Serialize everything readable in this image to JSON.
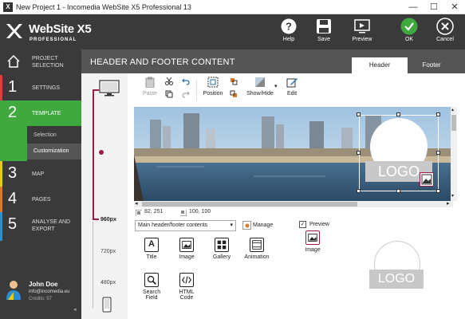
{
  "window": {
    "title": "New Project 1 - Incomedia WebSite X5 Professional 13",
    "minimize": "—",
    "maximize": "☐",
    "close": "✕"
  },
  "brand": {
    "name": "WebSite X5",
    "edition": "PROFESSIONAL"
  },
  "toolbar_top": {
    "help": "Help",
    "save": "Save",
    "preview": "Preview",
    "ok": "OK",
    "cancel": "Cancel"
  },
  "nav": [
    {
      "num": "",
      "label1": "PROJECT",
      "label2": "SELECTION",
      "color": "#3a3a3a"
    },
    {
      "num": "1",
      "label1": "SETTINGS",
      "label2": "",
      "color": "#e03c3c"
    },
    {
      "num": "2",
      "label1": "TEMPLATE",
      "label2": "",
      "color": "#3fa83f"
    },
    {
      "num": "3",
      "label1": "MAP",
      "label2": "",
      "color": "#e6c81e"
    },
    {
      "num": "4",
      "label1": "PAGES",
      "label2": "",
      "color": "#e07820"
    },
    {
      "num": "5",
      "label1": "ANALYSE AND",
      "label2": "EXPORT",
      "color": "#2a8fd0"
    }
  ],
  "subnav": {
    "selection": "Selection",
    "customization": "Customization"
  },
  "user": {
    "name": "John Doe",
    "email": "info@incomedia.eu",
    "credits": "Credits: 57"
  },
  "page": {
    "title": "HEADER AND FOOTER CONTENT",
    "tab_header": "Header",
    "tab_footer": "Footer"
  },
  "devices": {
    "w960": "960px",
    "w720": "720px",
    "w480": "480px"
  },
  "tools": {
    "paste": "Paste",
    "position": "Position",
    "showhide": "Show/Hide",
    "edit": "Edit"
  },
  "canvas": {
    "logo_text": "LOGO",
    "coord_pos": "82, 251",
    "coord_size": "100, 100"
  },
  "controls": {
    "select_value": "Main header/footer contents",
    "manage": "Manage",
    "preview_label": "Preview",
    "preview_checked": "✓"
  },
  "objects": [
    {
      "label1": "Title",
      "label2": ""
    },
    {
      "label1": "Image",
      "label2": ""
    },
    {
      "label1": "Gallery",
      "label2": ""
    },
    {
      "label1": "Animation",
      "label2": ""
    },
    {
      "label1": "Search",
      "label2": "Field"
    },
    {
      "label1": "HTML",
      "label2": "Code"
    }
  ],
  "preview": {
    "obj_label": "Image",
    "logo_text": "LOGO"
  },
  "colors": {
    "accent": "#9b1b4b",
    "ok_green": "#3fa83f"
  }
}
